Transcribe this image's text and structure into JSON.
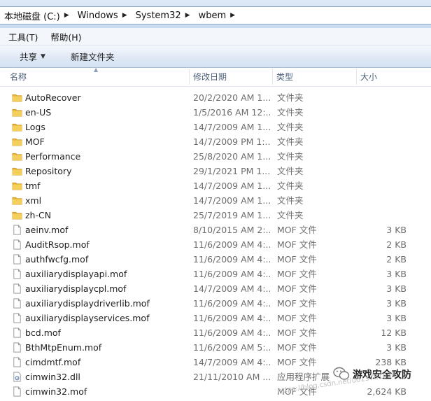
{
  "address_bar": {
    "crumbs": [
      "本地磁盘 (C:)",
      "Windows",
      "System32",
      "wbem"
    ]
  },
  "menu": {
    "items": [
      "工具(T)",
      "帮助(H)"
    ]
  },
  "toolbar": {
    "share_label": "共享",
    "new_folder_label": "新建文件夹"
  },
  "columns": {
    "name": "名称",
    "date": "修改日期",
    "type": "类型",
    "size": "大小"
  },
  "files": [
    {
      "name": "AutoRecover",
      "date": "20/2/2020 AM 1...",
      "type": "文件夹",
      "size": "",
      "kind": "folder"
    },
    {
      "name": "en-US",
      "date": "1/5/2016 AM 12:...",
      "type": "文件夹",
      "size": "",
      "kind": "folder"
    },
    {
      "name": "Logs",
      "date": "14/7/2009 AM 1...",
      "type": "文件夹",
      "size": "",
      "kind": "folder"
    },
    {
      "name": "MOF",
      "date": "14/7/2009 PM 1:...",
      "type": "文件夹",
      "size": "",
      "kind": "folder"
    },
    {
      "name": "Performance",
      "date": "25/8/2020 AM 1...",
      "type": "文件夹",
      "size": "",
      "kind": "folder"
    },
    {
      "name": "Repository",
      "date": "29/1/2021 PM 1...",
      "type": "文件夹",
      "size": "",
      "kind": "folder"
    },
    {
      "name": "tmf",
      "date": "14/7/2009 AM 1...",
      "type": "文件夹",
      "size": "",
      "kind": "folder"
    },
    {
      "name": "xml",
      "date": "14/7/2009 AM 1...",
      "type": "文件夹",
      "size": "",
      "kind": "folder"
    },
    {
      "name": "zh-CN",
      "date": "25/7/2019 AM 1...",
      "type": "文件夹",
      "size": "",
      "kind": "folder"
    },
    {
      "name": "aeinv.mof",
      "date": "8/10/2015 AM 2:...",
      "type": "MOF 文件",
      "size": "3 KB",
      "kind": "file"
    },
    {
      "name": "AuditRsop.mof",
      "date": "11/6/2009 AM 4:...",
      "type": "MOF 文件",
      "size": "2 KB",
      "kind": "file"
    },
    {
      "name": "authfwcfg.mof",
      "date": "11/6/2009 AM 4:...",
      "type": "MOF 文件",
      "size": "2 KB",
      "kind": "file"
    },
    {
      "name": "auxiliarydisplayapi.mof",
      "date": "11/6/2009 AM 4:...",
      "type": "MOF 文件",
      "size": "3 KB",
      "kind": "file"
    },
    {
      "name": "auxiliarydisplaycpl.mof",
      "date": "14/7/2009 AM 4:...",
      "type": "MOF 文件",
      "size": "3 KB",
      "kind": "file"
    },
    {
      "name": "auxiliarydisplaydriverlib.mof",
      "date": "11/6/2009 AM 4:...",
      "type": "MOF 文件",
      "size": "3 KB",
      "kind": "file"
    },
    {
      "name": "auxiliarydisplayservices.mof",
      "date": "11/6/2009 AM 4:...",
      "type": "MOF 文件",
      "size": "3 KB",
      "kind": "file"
    },
    {
      "name": "bcd.mof",
      "date": "11/6/2009 AM 4:...",
      "type": "MOF 文件",
      "size": "12 KB",
      "kind": "file"
    },
    {
      "name": "BthMtpEnum.mof",
      "date": "11/6/2009 AM 5:...",
      "type": "MOF 文件",
      "size": "3 KB",
      "kind": "file"
    },
    {
      "name": "cimdmtf.mof",
      "date": "14/7/2009 AM 4:...",
      "type": "MOF 文件",
      "size": "238 KB",
      "kind": "file"
    },
    {
      "name": "cimwin32.dll",
      "date": "21/11/2010 AM ...",
      "type": "应用程序扩展",
      "size": "",
      "kind": "dll"
    },
    {
      "name": "cimwin32.mof",
      "date": "",
      "type": "MOF 文件",
      "size": "2,624 KB",
      "kind": "file"
    }
  ],
  "watermark": {
    "name": "游戏安全攻防",
    "url": "https://blog.csdn.net/u013761036"
  },
  "colors": {
    "folder": "#e8b73a",
    "header_text": "#4c607a",
    "meta_text": "#6d6d6d"
  }
}
